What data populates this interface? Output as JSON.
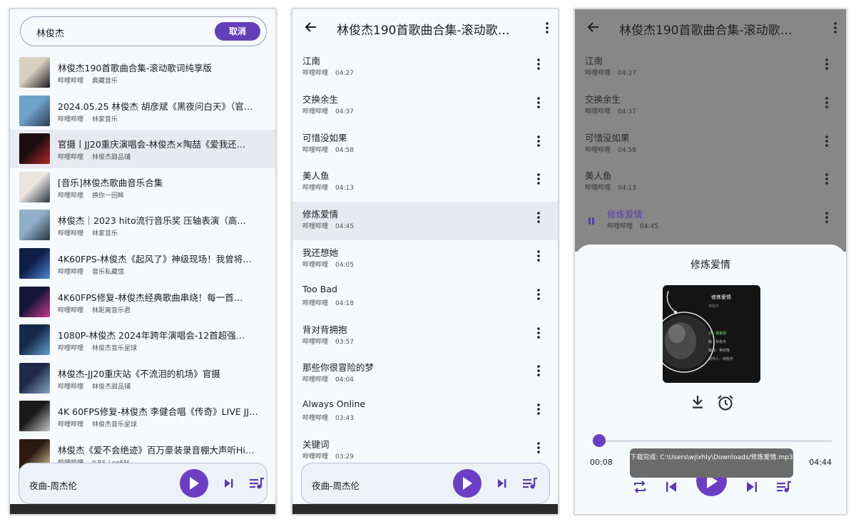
{
  "search": {
    "query": "林俊杰",
    "cancel_label": "取消"
  },
  "results": [
    {
      "title": "林俊杰190首歌曲合集-滚动歌词纯享版",
      "source": "哔哩哔哩",
      "uploader": "典藏音乐"
    },
    {
      "title": "2024.05.25 林俊杰 胡彦斌《黑夜问白天》（官…",
      "source": "哔哩哔哩",
      "uploader": "林家音乐"
    },
    {
      "title": "官摄丨JJ20重庆演唱会-林俊杰×陶喆《爱我还…",
      "source": "哔哩哔哩",
      "uploader": "林俊杰甜品铺"
    },
    {
      "title": "[音乐]林俊杰歌曲音乐合集",
      "source": "哔哩哔哩",
      "uploader": "换你一回眸"
    },
    {
      "title": "林俊杰｜2023 hito流行音乐奖 压轴表演（高…",
      "source": "哔哩哔哩",
      "uploader": "林家音乐"
    },
    {
      "title": "4K60FPS-林俊杰《起风了》神级现场！我曾将…",
      "source": "哔哩哔哩",
      "uploader": "音乐私藏馆"
    },
    {
      "title": "4K60FPS修复-林俊杰经典歌曲串烧！每一首…",
      "source": "哔哩哔哩",
      "uploader": "林距离音乐君"
    },
    {
      "title": "1080P-林俊杰 2024年跨年演唱会-12首超强…",
      "source": "哔哩哔哩",
      "uploader": "林俊杰音乐星球"
    },
    {
      "title": "林俊杰-JJ20重庆站《不流泪的机场》官摄",
      "source": "哔哩哔哩",
      "uploader": "林俊杰甜品铺"
    },
    {
      "title": "4K 60FPS修复-林俊杰 李健合唱《传奇》LIVE JJ…",
      "source": "哔哩哔哩",
      "uploader": "林俊杰音乐星球"
    },
    {
      "title": "林俊杰《爱不会绝迹》百万豪装录音棚大声听Hi…",
      "source": "哔哩哔哩",
      "uploader": "JLRS-LeoEM"
    }
  ],
  "mini_player": {
    "now_playing": "夜曲-周杰伦"
  },
  "playlist": {
    "title": "林俊杰190首歌曲合集-滚动歌…",
    "songs": [
      {
        "title": "江南",
        "source": "哔哩哔哩",
        "duration": "04:27"
      },
      {
        "title": "交换余生",
        "source": "哔哩哔哩",
        "duration": "04:37"
      },
      {
        "title": "可惜没如果",
        "source": "哔哩哔哩",
        "duration": "04:58"
      },
      {
        "title": "美人鱼",
        "source": "哔哩哔哩",
        "duration": "04:13"
      },
      {
        "title": "修炼爱情",
        "source": "哔哩哔哩",
        "duration": "04:45"
      },
      {
        "title": "我还想她",
        "source": "哔哩哔哩",
        "duration": "04:05"
      },
      {
        "title": "Too Bad",
        "source": "哔哩哔哩",
        "duration": "04:18"
      },
      {
        "title": "背对背拥抱",
        "source": "哔哩哔哩",
        "duration": "03:57"
      },
      {
        "title": "那些你很冒险的梦",
        "source": "哔哩哔哩",
        "duration": "04:04"
      },
      {
        "title": "Always Online",
        "source": "哔哩哔哩",
        "duration": "03:43"
      },
      {
        "title": "关键词",
        "source": "哔哩哔哩",
        "duration": "03:29"
      }
    ]
  },
  "player": {
    "title": "修炼爱情",
    "elapsed": "00:08",
    "total": "04:44",
    "progress_fraction": 0.03,
    "toast": "下载完成: C:\\Users\\wjlxhly\\Downloads/修炼爱情.mp3",
    "cover": {
      "title": "修炼爱情",
      "artist": "林俊杰",
      "lines": [
        "词：易家扬",
        "曲：林俊杰",
        "编曲：吴庆隆",
        "制作人：林俊杰"
      ]
    }
  },
  "colors": {
    "accent": "#6a3fc4",
    "background": "#f6fafd",
    "dim_overlay": "#878787",
    "selected_row": "#e7eaee"
  },
  "icons": {
    "back": "arrow-left-icon",
    "more": "more-vert-icon",
    "play": "play-icon",
    "next": "skip-next-icon",
    "queue": "queue-music-icon",
    "download": "download-icon",
    "timer": "alarm-icon",
    "repeat": "repeat-icon",
    "previous": "skip-previous-icon",
    "pause": "pause-icon"
  }
}
